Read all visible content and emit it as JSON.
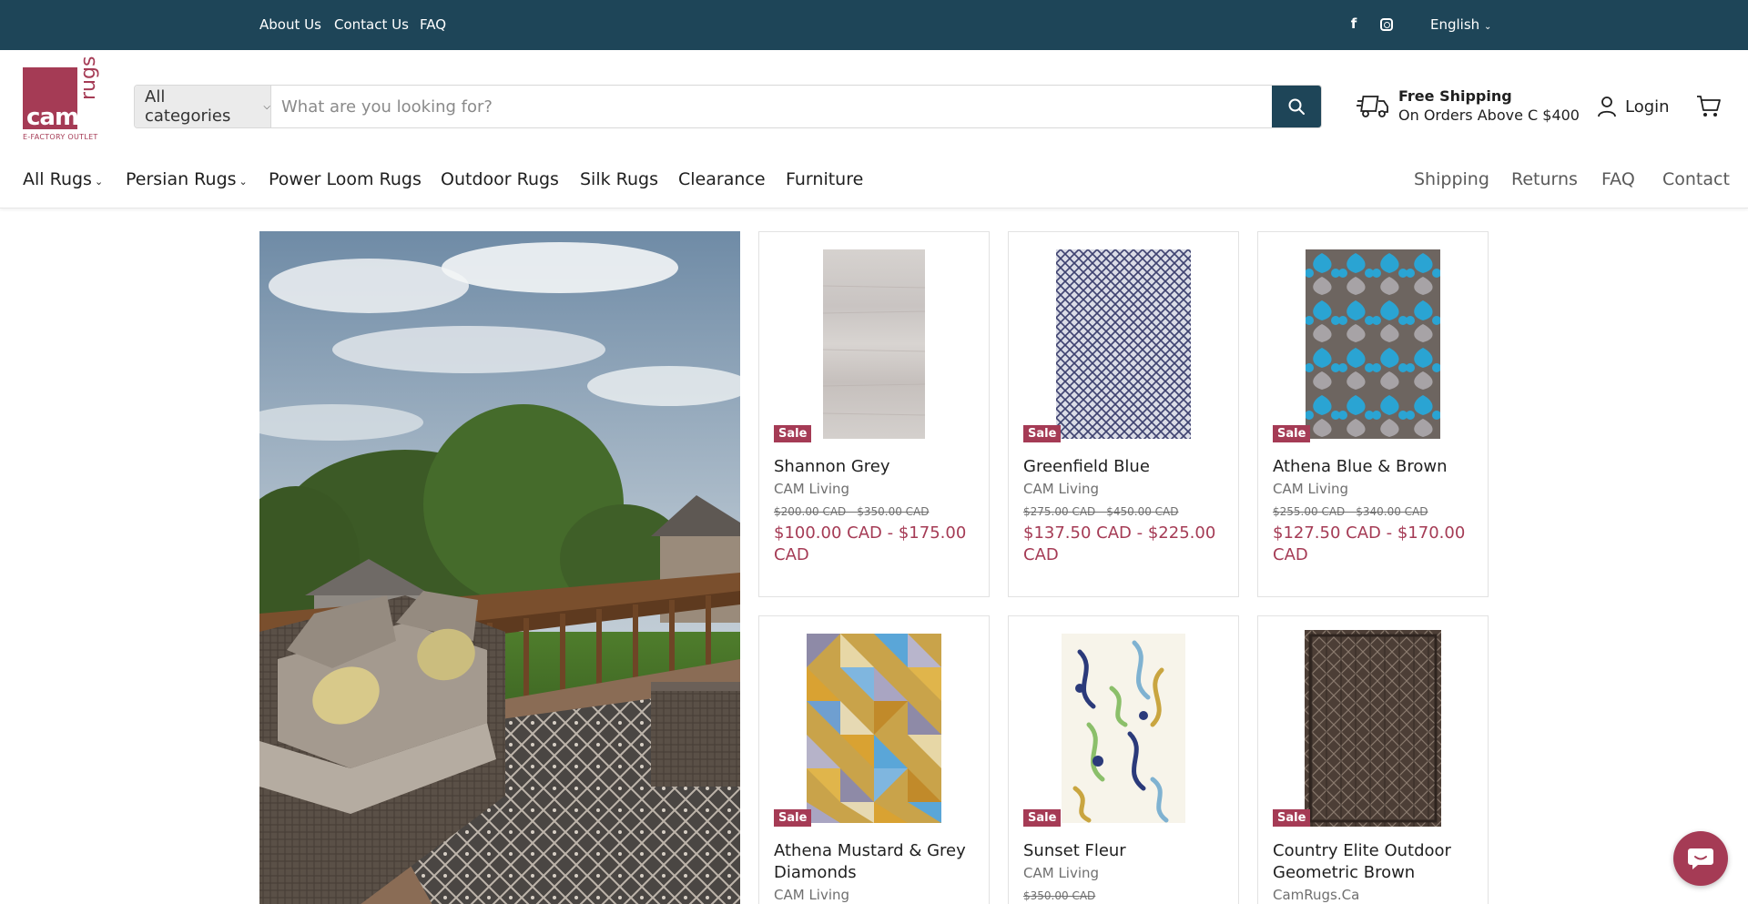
{
  "topbar": {
    "links": [
      "About Us",
      "Contact Us",
      "FAQ"
    ],
    "social": [
      {
        "icon": "facebook-icon",
        "glyph": "f"
      },
      {
        "icon": "instagram-icon"
      }
    ],
    "language": "English",
    "background": "#1e4558"
  },
  "logo": {
    "main": "cam",
    "vertical": "rugs",
    "tagline": "E-FACTORY OUTLET",
    "color": "#a53b55"
  },
  "search": {
    "category": "All categories",
    "placeholder": "What are you looking for?"
  },
  "shipping": {
    "title": "Free Shipping",
    "subtitle": "On Orders Above C $400"
  },
  "account": {
    "login": "Login"
  },
  "nav": {
    "left": [
      {
        "label": "All Rugs",
        "dropdown": true
      },
      {
        "label": "Persian Rugs",
        "dropdown": true
      },
      {
        "label": "Power Loom Rugs",
        "dropdown": false
      },
      {
        "label": "Outdoor Rugs",
        "dropdown": false
      },
      {
        "label": "Silk Rugs",
        "dropdown": false
      },
      {
        "label": "Clearance",
        "dropdown": false
      },
      {
        "label": "Furniture",
        "dropdown": false
      }
    ],
    "right": [
      "Shipping",
      "Returns",
      "FAQ",
      "Contact"
    ]
  },
  "products": [
    {
      "badge": "Sale",
      "name": "Shannon Grey",
      "vendor": "CAM Living",
      "was": "$200.00 CAD - $350.00 CAD",
      "now": "$100.00 CAD - $175.00 CAD"
    },
    {
      "badge": "Sale",
      "name": "Greenfield Blue",
      "vendor": "CAM Living",
      "was": "$275.00 CAD - $450.00 CAD",
      "now": "$137.50 CAD - $225.00 CAD"
    },
    {
      "badge": "Sale",
      "name": "Athena Blue & Brown",
      "vendor": "CAM Living",
      "was": "$255.00 CAD - $340.00 CAD",
      "now": "$127.50 CAD - $170.00 CAD"
    },
    {
      "badge": "Sale",
      "name": "Athena Mustard & Grey Diamonds",
      "vendor": "CAM Living",
      "was": "",
      "now": ""
    },
    {
      "badge": "Sale",
      "name": "Sunset Fleur",
      "vendor": "CAM Living",
      "was": "$350.00 CAD",
      "now": ""
    },
    {
      "badge": "Sale",
      "name": "Country Elite Outdoor Geometric Brown",
      "vendor": "CamRugs.Ca",
      "was": "",
      "now": ""
    }
  ],
  "colors": {
    "accent": "#a53b55",
    "brand_dark": "#1e4558"
  }
}
